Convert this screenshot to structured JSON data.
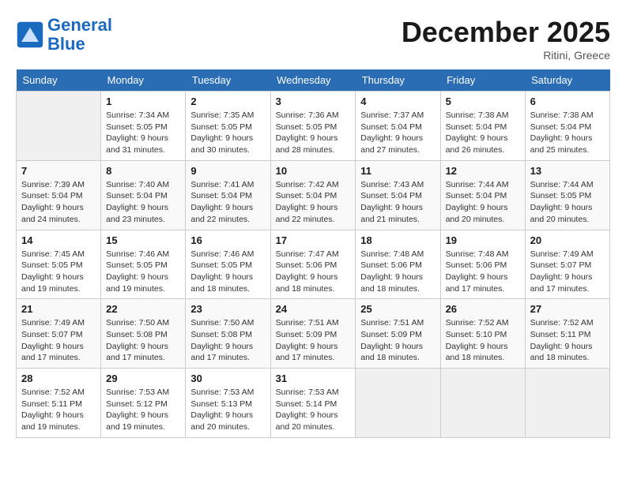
{
  "header": {
    "logo_line1": "General",
    "logo_line2": "Blue",
    "month": "December 2025",
    "location": "Ritini, Greece"
  },
  "weekdays": [
    "Sunday",
    "Monday",
    "Tuesday",
    "Wednesday",
    "Thursday",
    "Friday",
    "Saturday"
  ],
  "weeks": [
    [
      {
        "day": "",
        "info": ""
      },
      {
        "day": "1",
        "info": "Sunrise: 7:34 AM\nSunset: 5:05 PM\nDaylight: 9 hours and 31 minutes."
      },
      {
        "day": "2",
        "info": "Sunrise: 7:35 AM\nSunset: 5:05 PM\nDaylight: 9 hours and 30 minutes."
      },
      {
        "day": "3",
        "info": "Sunrise: 7:36 AM\nSunset: 5:05 PM\nDaylight: 9 hours and 28 minutes."
      },
      {
        "day": "4",
        "info": "Sunrise: 7:37 AM\nSunset: 5:04 PM\nDaylight: 9 hours and 27 minutes."
      },
      {
        "day": "5",
        "info": "Sunrise: 7:38 AM\nSunset: 5:04 PM\nDaylight: 9 hours and 26 minutes."
      },
      {
        "day": "6",
        "info": "Sunrise: 7:38 AM\nSunset: 5:04 PM\nDaylight: 9 hours and 25 minutes."
      }
    ],
    [
      {
        "day": "7",
        "info": "Sunrise: 7:39 AM\nSunset: 5:04 PM\nDaylight: 9 hours and 24 minutes."
      },
      {
        "day": "8",
        "info": "Sunrise: 7:40 AM\nSunset: 5:04 PM\nDaylight: 9 hours and 23 minutes."
      },
      {
        "day": "9",
        "info": "Sunrise: 7:41 AM\nSunset: 5:04 PM\nDaylight: 9 hours and 22 minutes."
      },
      {
        "day": "10",
        "info": "Sunrise: 7:42 AM\nSunset: 5:04 PM\nDaylight: 9 hours and 22 minutes."
      },
      {
        "day": "11",
        "info": "Sunrise: 7:43 AM\nSunset: 5:04 PM\nDaylight: 9 hours and 21 minutes."
      },
      {
        "day": "12",
        "info": "Sunrise: 7:44 AM\nSunset: 5:04 PM\nDaylight: 9 hours and 20 minutes."
      },
      {
        "day": "13",
        "info": "Sunrise: 7:44 AM\nSunset: 5:05 PM\nDaylight: 9 hours and 20 minutes."
      }
    ],
    [
      {
        "day": "14",
        "info": "Sunrise: 7:45 AM\nSunset: 5:05 PM\nDaylight: 9 hours and 19 minutes."
      },
      {
        "day": "15",
        "info": "Sunrise: 7:46 AM\nSunset: 5:05 PM\nDaylight: 9 hours and 19 minutes."
      },
      {
        "day": "16",
        "info": "Sunrise: 7:46 AM\nSunset: 5:05 PM\nDaylight: 9 hours and 18 minutes."
      },
      {
        "day": "17",
        "info": "Sunrise: 7:47 AM\nSunset: 5:06 PM\nDaylight: 9 hours and 18 minutes."
      },
      {
        "day": "18",
        "info": "Sunrise: 7:48 AM\nSunset: 5:06 PM\nDaylight: 9 hours and 18 minutes."
      },
      {
        "day": "19",
        "info": "Sunrise: 7:48 AM\nSunset: 5:06 PM\nDaylight: 9 hours and 17 minutes."
      },
      {
        "day": "20",
        "info": "Sunrise: 7:49 AM\nSunset: 5:07 PM\nDaylight: 9 hours and 17 minutes."
      }
    ],
    [
      {
        "day": "21",
        "info": "Sunrise: 7:49 AM\nSunset: 5:07 PM\nDaylight: 9 hours and 17 minutes."
      },
      {
        "day": "22",
        "info": "Sunrise: 7:50 AM\nSunset: 5:08 PM\nDaylight: 9 hours and 17 minutes."
      },
      {
        "day": "23",
        "info": "Sunrise: 7:50 AM\nSunset: 5:08 PM\nDaylight: 9 hours and 17 minutes."
      },
      {
        "day": "24",
        "info": "Sunrise: 7:51 AM\nSunset: 5:09 PM\nDaylight: 9 hours and 17 minutes."
      },
      {
        "day": "25",
        "info": "Sunrise: 7:51 AM\nSunset: 5:09 PM\nDaylight: 9 hours and 18 minutes."
      },
      {
        "day": "26",
        "info": "Sunrise: 7:52 AM\nSunset: 5:10 PM\nDaylight: 9 hours and 18 minutes."
      },
      {
        "day": "27",
        "info": "Sunrise: 7:52 AM\nSunset: 5:11 PM\nDaylight: 9 hours and 18 minutes."
      }
    ],
    [
      {
        "day": "28",
        "info": "Sunrise: 7:52 AM\nSunset: 5:11 PM\nDaylight: 9 hours and 19 minutes."
      },
      {
        "day": "29",
        "info": "Sunrise: 7:53 AM\nSunset: 5:12 PM\nDaylight: 9 hours and 19 minutes."
      },
      {
        "day": "30",
        "info": "Sunrise: 7:53 AM\nSunset: 5:13 PM\nDaylight: 9 hours and 20 minutes."
      },
      {
        "day": "31",
        "info": "Sunrise: 7:53 AM\nSunset: 5:14 PM\nDaylight: 9 hours and 20 minutes."
      },
      {
        "day": "",
        "info": ""
      },
      {
        "day": "",
        "info": ""
      },
      {
        "day": "",
        "info": ""
      }
    ]
  ]
}
